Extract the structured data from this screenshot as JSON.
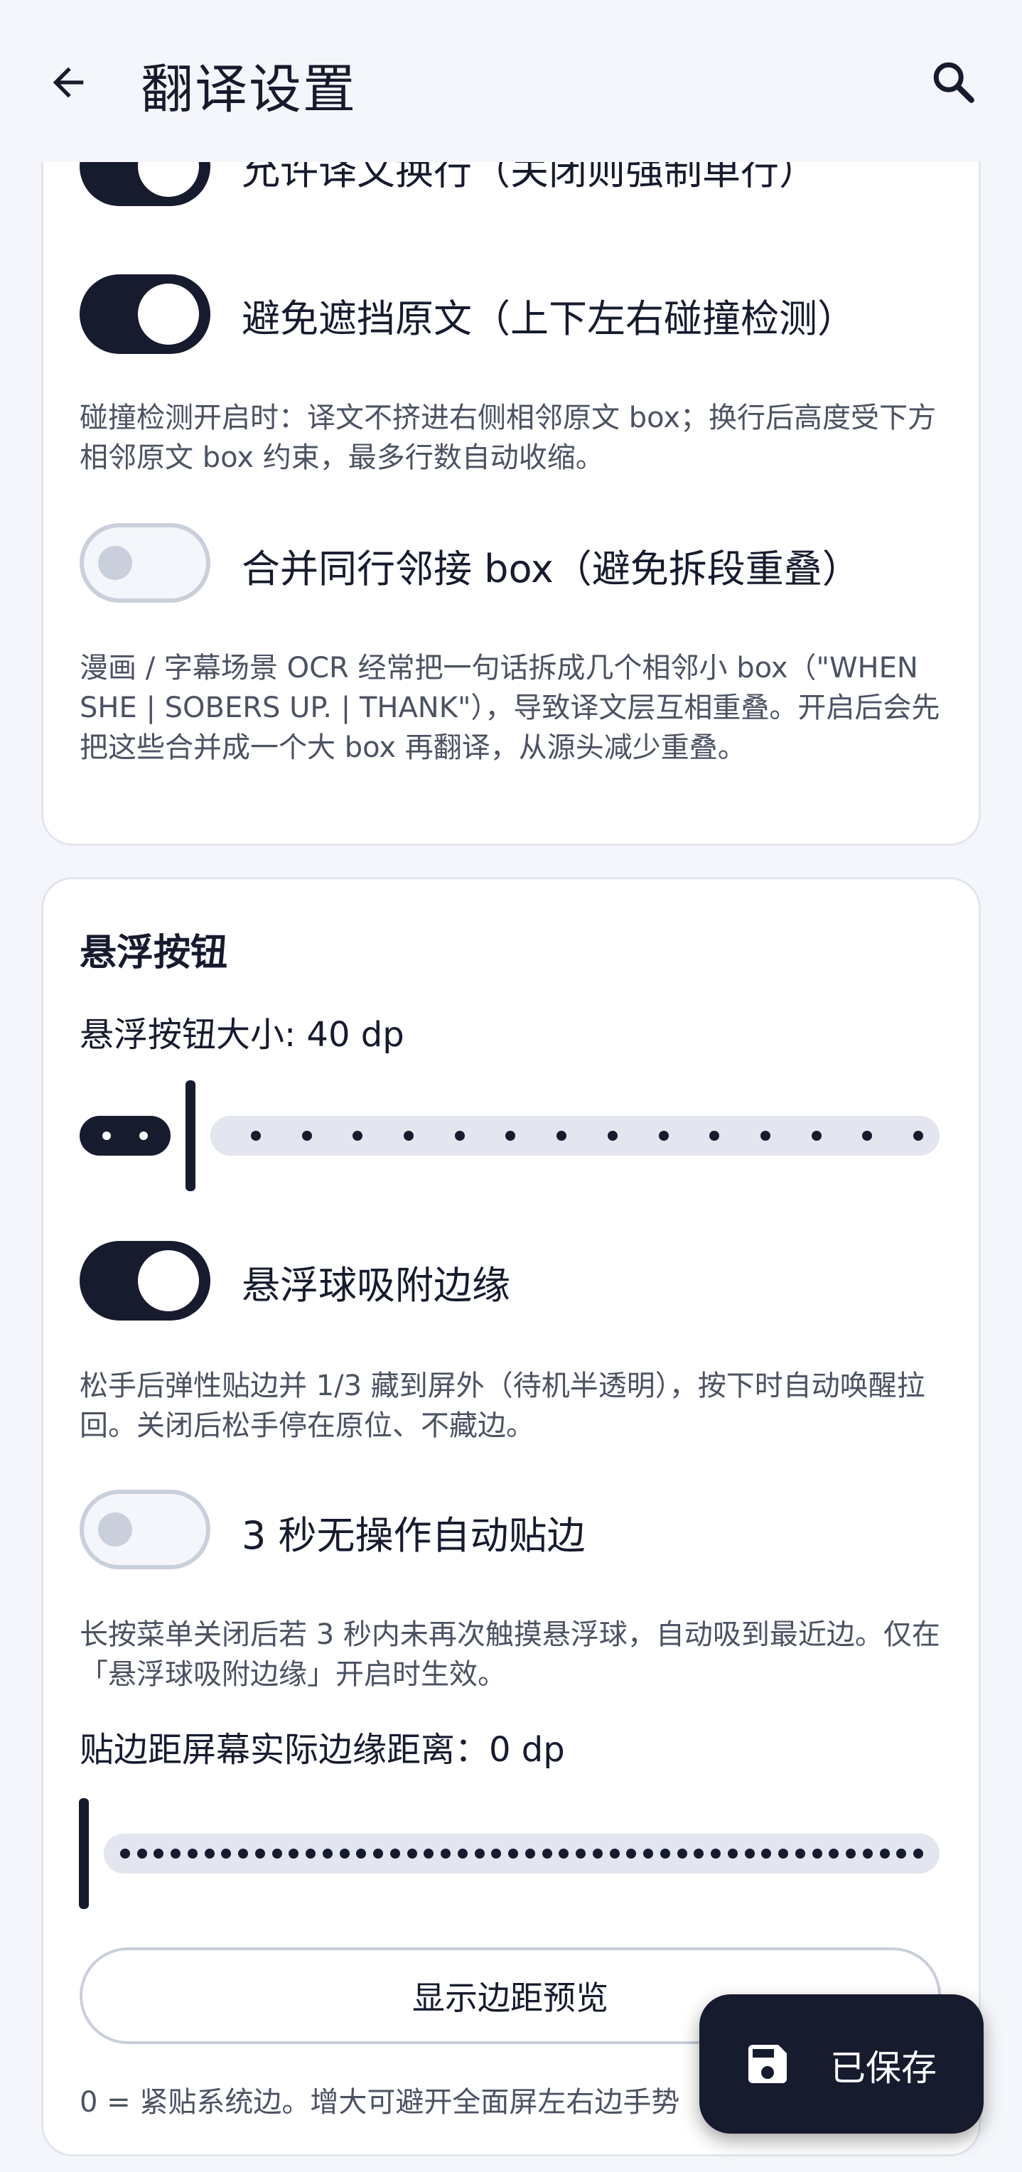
{
  "appbar": {
    "title": "翻译设置",
    "back_icon": "arrow-left-icon",
    "search_icon": "search-icon"
  },
  "translation_section": {
    "allow_wrap": {
      "label": "允许译文换行（关闭则强制单行）",
      "on": true
    },
    "avoid_overlap": {
      "label": "避免遮挡原文（上下左右碰撞检测）",
      "on": true
    },
    "avoid_overlap_desc": "碰撞检测开启时：译文不挤进右侧相邻原文 box；换行后高度受下方相邻原文 box 约束，最多行数自动收缩。",
    "merge_boxes": {
      "label": "合并同行邻接 box（避免拆段重叠）",
      "on": false
    },
    "merge_boxes_desc": "漫画 / 字幕场景 OCR 经常把一句话拆成几个相邻小 box（\"WHEN SHE | SOBERS UP. | THANK\"），导致译文层互相重叠。开启后会先把这些合并成一个大 box 再翻译，从源头减少重叠。"
  },
  "floating_section": {
    "title": "悬浮按钮",
    "size_label": "悬浮按钮大小: 40 dp",
    "size_value": 40,
    "size_fraction": 0.0,
    "snap_edge": {
      "label": "悬浮球吸附边缘",
      "on": true
    },
    "snap_edge_desc": "松手后弹性贴边并 1/3 藏到屏外（待机半透明），按下时自动唤醒拉回。关闭后松手停在原位、不藏边。",
    "auto_snap": {
      "label": "3 秒无操作自动贴边",
      "on": false
    },
    "auto_snap_desc": "长按菜单关闭后若 3 秒内未再次触摸悬浮球，自动吸到最近边。仅在「悬浮球吸附边缘」开启时生效。",
    "margin_label": "贴边距屏幕实际边缘距离：0 dp",
    "margin_value": 0,
    "margin_fraction": 0.0,
    "preview_button": "显示边距预览",
    "footer_note": "0 = 紧贴系统边。增大可避开全面屏左右边手势"
  },
  "fab": {
    "label": "已保存",
    "icon": "save-icon"
  },
  "colors": {
    "primary": "#161b2e",
    "track_inactive": "#e3e6ef",
    "background": "#f4f6fb",
    "card": "#ffffff"
  }
}
